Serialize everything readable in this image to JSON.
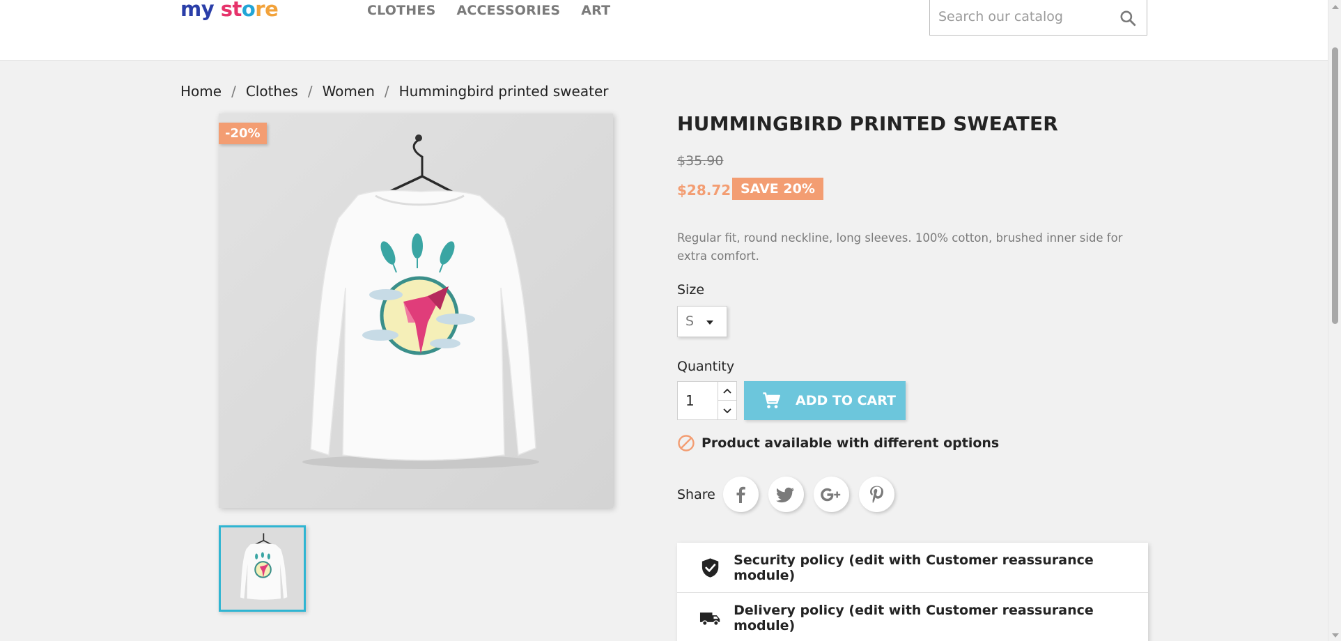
{
  "store": {
    "logo_part1": "my",
    "logo_part2": "st",
    "logo_part3": "o",
    "logo_part4": "re"
  },
  "nav": {
    "items": [
      "CLOTHES",
      "ACCESSORIES",
      "ART"
    ]
  },
  "search": {
    "placeholder": "Search our catalog"
  },
  "breadcrumb": {
    "items": [
      "Home",
      "Clothes",
      "Women",
      "Hummingbird printed sweater"
    ],
    "separator": "/"
  },
  "product": {
    "discount_flag": "-20%",
    "title": "HUMMINGBIRD PRINTED SWEATER",
    "old_price": "$35.90",
    "price": "$28.72",
    "save_badge": "SAVE 20%",
    "description": "Regular fit, round neckline, long sleeves. 100% cotton, brushed inner side for extra comfort.",
    "size_label": "Size",
    "size_value": "S",
    "quantity_label": "Quantity",
    "quantity_value": "1",
    "add_to_cart": "ADD TO CART",
    "availability": "Product available with different options",
    "share_label": "Share"
  },
  "reassurance": {
    "security": "Security policy (edit with Customer reassurance module)",
    "delivery": "Delivery policy (edit with Customer reassurance module)"
  },
  "colors": {
    "accent": "#2fb5d2",
    "discount": "#f39d72",
    "cart_button": "#6cc6dc"
  },
  "icons": [
    "search-icon",
    "cart-icon",
    "ban-icon",
    "facebook-icon",
    "twitter-icon",
    "google-plus-icon",
    "pinterest-icon",
    "shield-check-icon",
    "truck-icon"
  ]
}
